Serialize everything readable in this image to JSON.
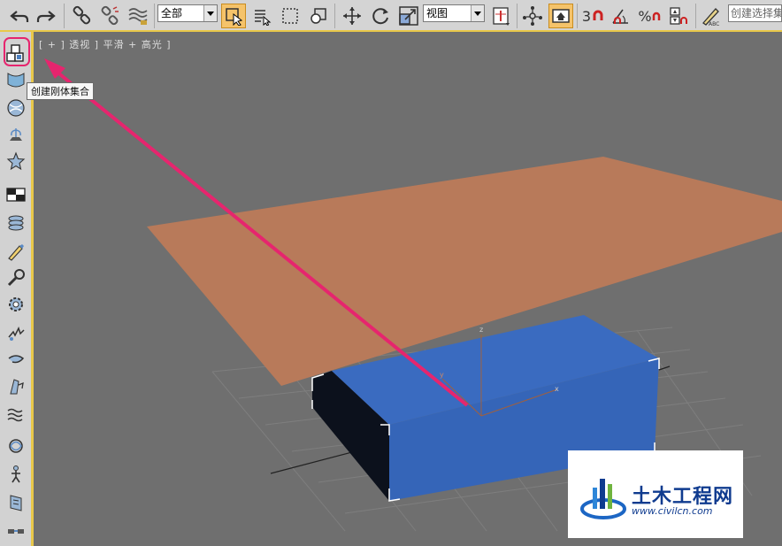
{
  "toolbar": {
    "selection_filter": "全部",
    "ref_coord_system": "视图",
    "snap_label": "3",
    "angle_snap_label": "%",
    "named_selection_placeholder": "创建选择集"
  },
  "viewport": {
    "label": "[ + ] 透视 ] 平滑 + 高光 ]",
    "axis_x": "x",
    "axis_y": "y",
    "axis_z": "z"
  },
  "tooltip": {
    "text": "创建刚体集合"
  },
  "watermark": {
    "title": "土木工程网",
    "url": "www.civilcn.com"
  },
  "colors": {
    "plane": "#b87a5a",
    "box_top": "#3a6bc0",
    "box_front": "#3565b8",
    "box_side": "#0c111c",
    "arrow": "#e6256e",
    "active_border": "#e8c84a"
  },
  "left_toolbar_icons": [
    "rigid-body-collection-icon",
    "cloth-icon",
    "sphere-icon",
    "fountain-icon",
    "star-icon",
    "plane-icon",
    "layers-icon",
    "pen-icon",
    "wrench-icon",
    "gear-icon",
    "spring-icon",
    "wind-icon",
    "paint-icon",
    "wave-icon",
    "rope-icon",
    "figure-icon",
    "panel-icon",
    "chain-icon"
  ]
}
